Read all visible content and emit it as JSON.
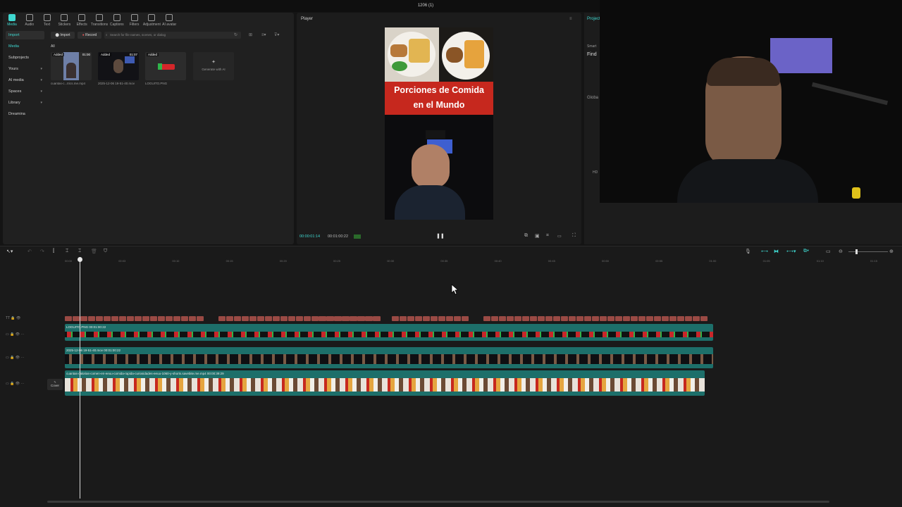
{
  "window": {
    "title": "1206 (1)"
  },
  "toolbar": {
    "items": [
      {
        "label": "Media",
        "active": true
      },
      {
        "label": "Audio"
      },
      {
        "label": "Text"
      },
      {
        "label": "Stickers"
      },
      {
        "label": "Effects"
      },
      {
        "label": "Transitions"
      },
      {
        "label": "Captions"
      },
      {
        "label": "Filters"
      },
      {
        "label": "Adjustment"
      },
      {
        "label": "AI avatar"
      }
    ]
  },
  "sidebar": {
    "items": [
      {
        "label": "Import",
        "active": true
      },
      {
        "label": "Media",
        "accent": true
      },
      {
        "label": "Subprojects"
      },
      {
        "label": "Yours",
        "chevron": true
      },
      {
        "label": "AI media",
        "chevron": true
      },
      {
        "label": "Spaces",
        "chevron": true
      },
      {
        "label": "Library",
        "chevron": true
      },
      {
        "label": "Dreamina"
      }
    ]
  },
  "media": {
    "import_label": "Import",
    "record_label": "Record",
    "search_placeholder": "Search for file names, scenes, or dialog",
    "filter_label": "All",
    "items": [
      {
        "badge": "Added",
        "duration": "01:00",
        "name": "cuantas-c...trics.me.mp4"
      },
      {
        "badge": "Added",
        "duration": "01:07",
        "name": "2025-12-06 19-51-40.mov"
      },
      {
        "badge": "Added",
        "duration": "",
        "name": "LOGUITO.PNG"
      }
    ],
    "generate_label": "Generate with AI"
  },
  "player": {
    "title": "Player",
    "banner_line1": "Porciones de Comida",
    "banner_line2": "en el Mundo",
    "current_time": "00:00:01:14",
    "total_time": "00:01:00:22",
    "pause_symbol": "❚❚"
  },
  "right_panel": {
    "title": "Project",
    "find_label": "Find",
    "smart_label": "Smart",
    "global_label": "Globa",
    "hd_label": "HD"
  },
  "timeline": {
    "ruler_ticks": [
      "00:00",
      "00:03",
      "00:10",
      "00:15",
      "00:20",
      "00:25",
      "00:30",
      "00:35",
      "00:40",
      "00:45",
      "00:50",
      "00:55",
      "01:00",
      "01:05",
      "01:10",
      "01:15"
    ],
    "tracks": [
      {
        "label": "LOGUITO.PNG  00:01:00:22"
      },
      {
        "label": "2025-12-06 19-51-40.mov  00:01:00:22"
      },
      {
        "label": "cuantas-calorias-comen-en-eeuu-comida-rapida-curiosidades-eeuu-1060-y-shorts.savebite.me.mp4  00:00:39:29"
      }
    ],
    "cover_label": "Cover"
  },
  "colors": {
    "accent": "#3fd8d0",
    "caption_clip": "#9a4a44",
    "track_teal": "#1d6f6a"
  }
}
